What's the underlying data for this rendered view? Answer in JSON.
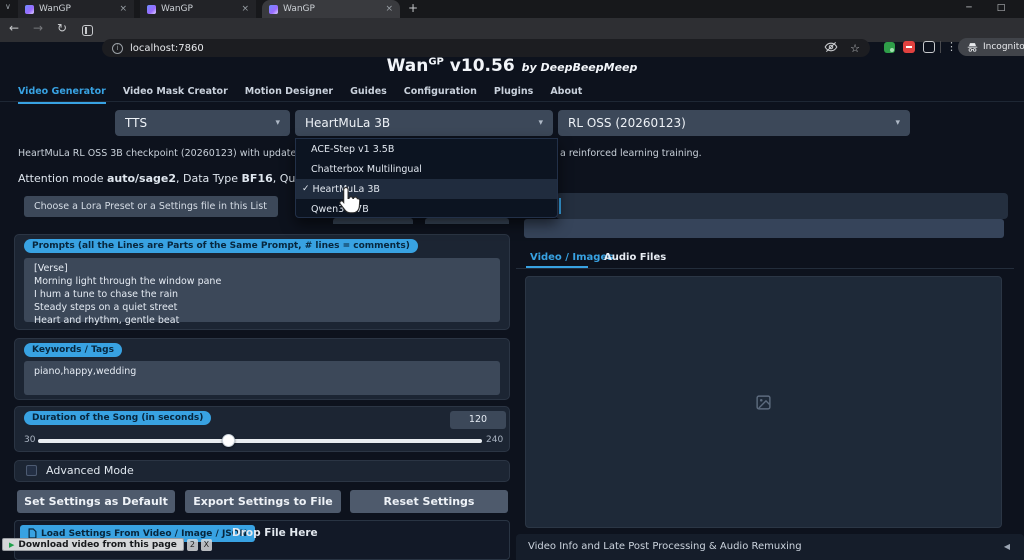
{
  "icons": {
    "tab_search_chevron": "∨",
    "tab_close": "×",
    "new_tab": "+",
    "window_minimize": "─",
    "window_maximize": "□",
    "back": "←",
    "forward": "→",
    "reload": "↻",
    "page_info": "i",
    "bookmark_star": "☆",
    "more_menu": "⋮",
    "select_caret": "▾",
    "selected_check": "✓",
    "accordion_arrow": "◀",
    "download_play": "▶"
  },
  "browser": {
    "tabs": [
      {
        "title": "WanGP"
      },
      {
        "title": "WanGP"
      },
      {
        "title": "WanGP"
      }
    ],
    "url": "localhost:7860",
    "incognito_label": "Incognito",
    "download_bubble": {
      "label": "Download video from this page",
      "count": "2",
      "close": "X"
    }
  },
  "header": {
    "app_name": "Wan",
    "app_sup": "GP",
    "version": " v10.56",
    "byline": "by DeepBeepMeep"
  },
  "nav": {
    "tabs": [
      {
        "label": "Video Generator"
      },
      {
        "label": "Video Mask Creator"
      },
      {
        "label": "Motion Designer"
      },
      {
        "label": "Guides"
      },
      {
        "label": "Configuration"
      },
      {
        "label": "Plugins"
      },
      {
        "label": "About"
      }
    ]
  },
  "model_selects": {
    "family": "TTS",
    "model": "HeartMuLa 3B",
    "variant": "RL OSS (20260123)"
  },
  "model_dropdown": {
    "options": [
      {
        "label": "ACE-Step v1 3.5B"
      },
      {
        "label": "Chatterbox Multilingual"
      },
      {
        "label": "HeartMuLa 3B"
      },
      {
        "label": "Qwen3 1.7B"
      }
    ]
  },
  "info": {
    "checkpoint_left": "HeartMuLa RL OSS 3B checkpoint (20260123) with updated codec supp",
    "checkpoint_right": "a reinforced learning training.",
    "attn_1": "Attention mode ",
    "attn_b1": "auto/sage2",
    "attn_2": ", Data Type ",
    "attn_b2": "BF16",
    "attn_3": ", Quantization I"
  },
  "lora": {
    "placeholder": "Choose a Lora Preset or a Settings file in this List"
  },
  "prompts": {
    "label": "Prompts (all the Lines are Parts of the Same Prompt, # lines = comments)",
    "value": "[Verse]\nMorning light through the window pane\nI hum a tune to chase the rain\nSteady steps on a quiet street\nHeart and rhythm, gentle beat"
  },
  "keywords": {
    "label": "Keywords / Tags",
    "value": "piano,happy,wedding"
  },
  "duration": {
    "label": "Duration of the Song (in seconds)",
    "value": "120",
    "min": "30",
    "max": "240"
  },
  "advanced": {
    "label": "Advanced Mode"
  },
  "settings_buttons": {
    "set_default": "Set Settings as Default",
    "export": "Export Settings to File",
    "reset": "Reset Settings"
  },
  "load_settings": {
    "button": "Load Settings From Video / Image / JSON",
    "drop_hint": "Drop File Here"
  },
  "right_panel": {
    "tab_video": "Video / Images",
    "tab_audio": "Audio Files",
    "accordion_label": "Video Info and Late Post Processing & Audio Remuxing"
  },
  "colors": {
    "accent_blue": "#38a2e2",
    "pill_text": "#07263d",
    "panel_bg": "#1c2533",
    "input_bg": "#3c4859",
    "page_bg": "#0d121d"
  }
}
